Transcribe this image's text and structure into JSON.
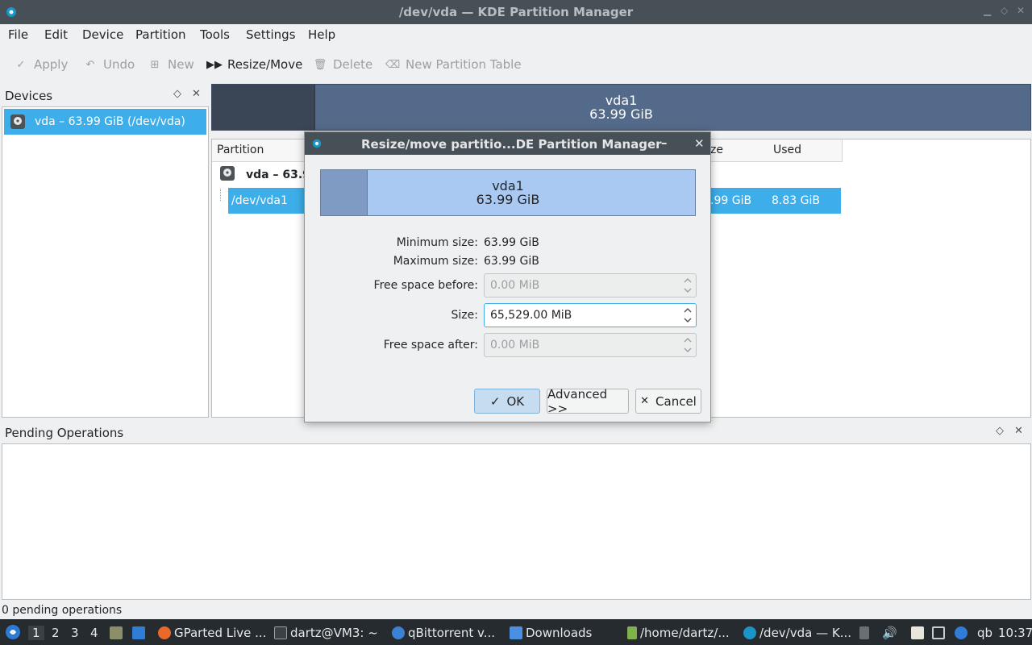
{
  "window": {
    "title": "/dev/vda — KDE Partition Manager"
  },
  "menu": [
    "File",
    "Edit",
    "Device",
    "Partition",
    "Tools",
    "Settings",
    "Help"
  ],
  "toolbar": {
    "apply": "Apply",
    "undo": "Undo",
    "new": "New",
    "resize_move": "Resize/Move",
    "delete": "Delete",
    "new_partition_table": "New Partition Table"
  },
  "devices": {
    "header": "Devices",
    "items": [
      {
        "label": "vda – 63.99 GiB (/dev/vda)"
      }
    ]
  },
  "partition_graph": {
    "name": "vda1",
    "size": "63.99 GiB"
  },
  "partition_table": {
    "headers": {
      "partition": "Partition",
      "size": "ze",
      "used": "Used"
    },
    "device_row": "vda – 63.99",
    "partition_row": {
      "name": "/dev/vda1",
      "size": ".99 GiB",
      "used": "8.83 GiB"
    }
  },
  "pending": {
    "header": "Pending Operations",
    "status": "0 pending operations"
  },
  "dialog": {
    "title": "Resize/move partitio...DE Partition Manager",
    "graph": {
      "name": "vda1",
      "size": "63.99 GiB"
    },
    "min_label": "Minimum size:",
    "min_value": "63.99 GiB",
    "max_label": "Maximum size:",
    "max_value": "63.99 GiB",
    "free_before_label": "Free space before:",
    "free_before_value": "0.00 MiB",
    "size_label": "Size:",
    "size_value": "65,529.00 MiB",
    "free_after_label": "Free space after:",
    "free_after_value": "0.00 MiB",
    "ok": "OK",
    "advanced": "Advanced >>",
    "cancel": "Cancel"
  },
  "taskbar": {
    "workspaces": [
      "1",
      "2",
      "3",
      "4"
    ],
    "tasks": [
      {
        "label": "GParted Live ..."
      },
      {
        "label": "dartz@VM3: ~"
      },
      {
        "label": "qBittorrent v..."
      },
      {
        "label": "Downloads"
      },
      {
        "label": "/home/dartz/..."
      },
      {
        "label": "/dev/vda — K..."
      }
    ],
    "tray_qb": "qb",
    "clock": "10:37"
  }
}
